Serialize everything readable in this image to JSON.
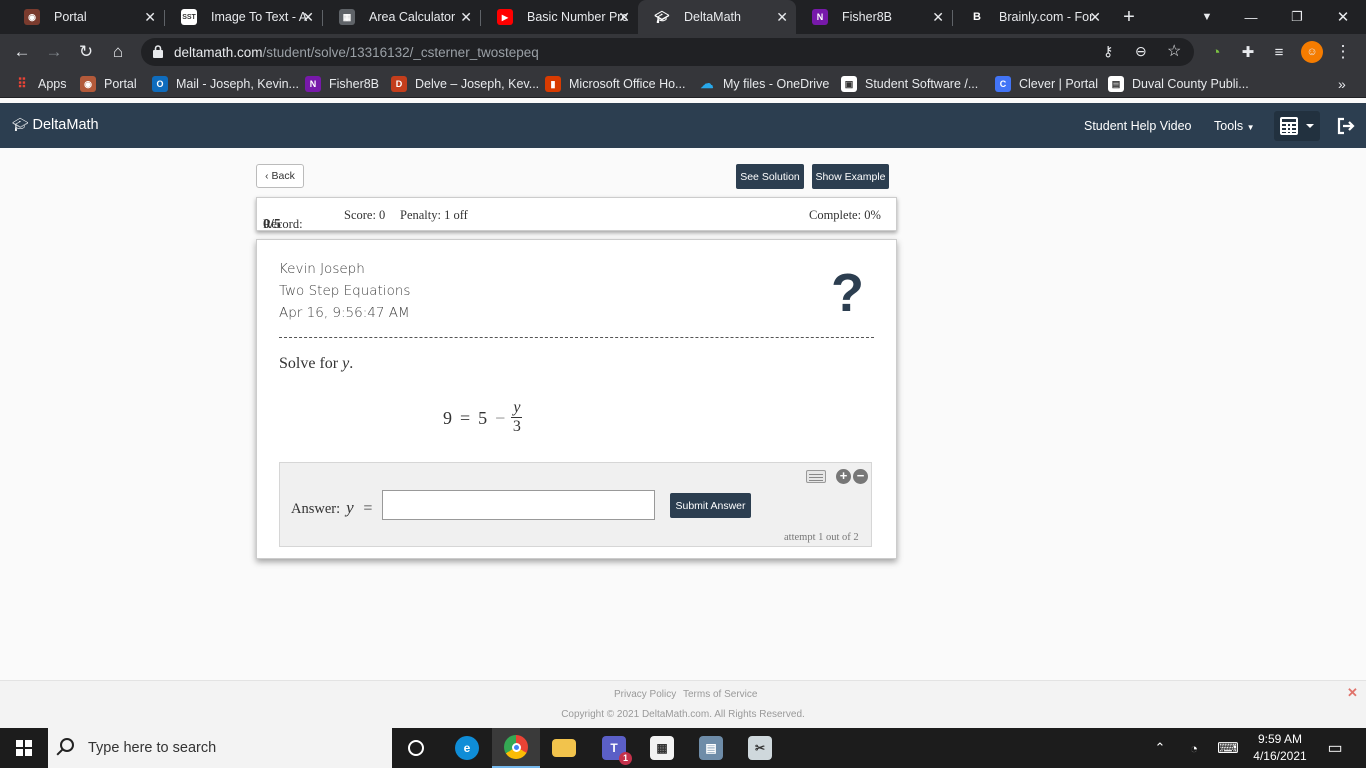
{
  "browser": {
    "tabs": [
      {
        "title": "Portal",
        "favicon": "portal-icon",
        "color": "#7a3b2e"
      },
      {
        "title": "Image To Text - A",
        "favicon": "sst-icon",
        "color": "#4a4a4a"
      },
      {
        "title": "Area Calculator",
        "favicon": "calculator-icon",
        "color": "#3c4043"
      },
      {
        "title": "Basic Number Pro",
        "favicon": "youtube-icon",
        "color": "#ff0000"
      },
      {
        "title": "DeltaMath",
        "favicon": "deltamath-icon",
        "color": "#35363a"
      },
      {
        "title": "Fisher8B",
        "favicon": "onenote-icon",
        "color": "#7719aa"
      },
      {
        "title": "Brainly.com - For",
        "favicon": "brainly-icon",
        "color": "#202124"
      }
    ],
    "url_host": "deltamath.com",
    "url_path": "/student/solve/13316132/_csterner_twostepeq",
    "bookmarks": [
      {
        "label": "Apps",
        "icon": "apps-grid-icon",
        "color": "#ea4335"
      },
      {
        "label": "Portal",
        "icon": "portal-icon",
        "color": "#b35a3a"
      },
      {
        "label": "Mail - Joseph, Kevin...",
        "icon": "outlook-icon",
        "color": "#0f6cbd"
      },
      {
        "label": "Fisher8B",
        "icon": "onenote-icon",
        "color": "#7719aa"
      },
      {
        "label": "Delve – Joseph, Kev...",
        "icon": "delve-icon",
        "color": "#c43e1c"
      },
      {
        "label": "Microsoft Office Ho...",
        "icon": "office-icon",
        "color": "#d83b01"
      },
      {
        "label": "My files - OneDrive",
        "icon": "onedrive-icon",
        "color": "#0078d4"
      },
      {
        "label": "Student Software /...",
        "icon": "student-software-icon",
        "color": "#ffffff"
      },
      {
        "label": "Clever | Portal",
        "icon": "clever-icon",
        "color": "#4274f6"
      },
      {
        "label": "Duval County Publi...",
        "icon": "duval-icon",
        "color": "#ffffff"
      }
    ]
  },
  "app": {
    "logo": "DeltaMath",
    "nav": {
      "help": "Student Help Video",
      "tools": "Tools"
    }
  },
  "toolbar": {
    "back": "Back",
    "see_solution": "See Solution",
    "show_example": "Show Example"
  },
  "record": {
    "record_label": "Record:",
    "record_value": "0/5",
    "score": "Score: 0",
    "penalty": "Penalty: 1 off",
    "complete": "Complete: 0%"
  },
  "problem": {
    "student": "Kevin Joseph",
    "assignment": "Two Step Equations",
    "timestamp": "Apr 16, 9:56:47 AM",
    "help_symbol": "?",
    "prompt_prefix": "Solve for",
    "variable": "y",
    "equation": {
      "lhs": "9",
      "eq": "=",
      "a": "5",
      "op": "−",
      "num": "y",
      "den": "3"
    }
  },
  "answer": {
    "label": "Answer:",
    "variable": "y",
    "eq": "=",
    "value": "",
    "submit": "Submit Answer",
    "attempt": "attempt 1 out of 2"
  },
  "footer": {
    "privacy": "Privacy Policy",
    "terms": "Terms of Service",
    "copyright": "Copyright © 2021 DeltaMath.com. All Rights Reserved."
  },
  "taskbar": {
    "search_placeholder": "Type here to search",
    "time": "9:59 AM",
    "date": "4/16/2021",
    "teams_badge": "1"
  }
}
